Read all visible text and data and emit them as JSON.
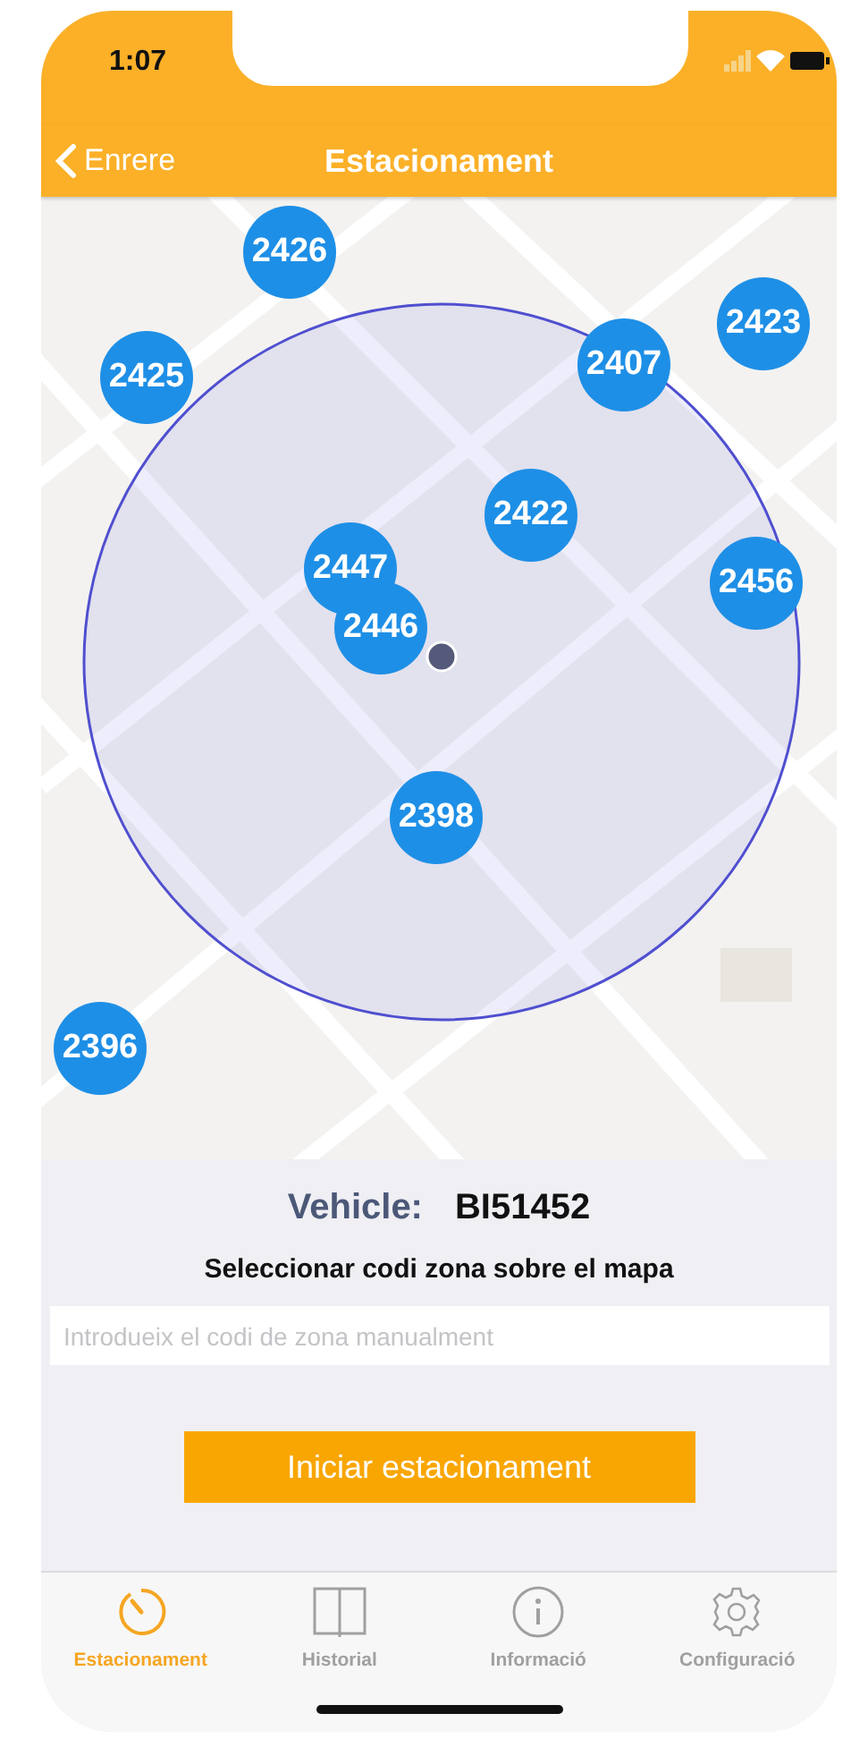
{
  "status_bar": {
    "time": "1:07"
  },
  "nav_bar": {
    "back": "Enrere",
    "title": "Estacionament"
  },
  "map": {
    "markers": [
      {
        "label": "2426"
      },
      {
        "label": "2425"
      },
      {
        "label": "2407"
      },
      {
        "label": "2423"
      },
      {
        "label": "2422"
      },
      {
        "label": "2456"
      },
      {
        "label": "2447"
      },
      {
        "label": "2446"
      },
      {
        "label": "2398"
      },
      {
        "label": "2396"
      }
    ]
  },
  "vehicle": {
    "label": "Vehicle:",
    "plate": "BI51452"
  },
  "instruction": "Seleccionar codi zona sobre el mapa",
  "zone_field": {
    "placeholder": "Introdueix el codi de zona manualment"
  },
  "start_button": "Iniciar estacionament",
  "tabs": [
    {
      "label": "Estacionament",
      "kind": "stopwatch",
      "selected": true
    },
    {
      "label": "Historial",
      "kind": "book",
      "selected": false
    },
    {
      "label": "Informació",
      "kind": "info",
      "selected": false
    },
    {
      "label": "Configuració",
      "kind": "gear",
      "selected": false
    }
  ]
}
